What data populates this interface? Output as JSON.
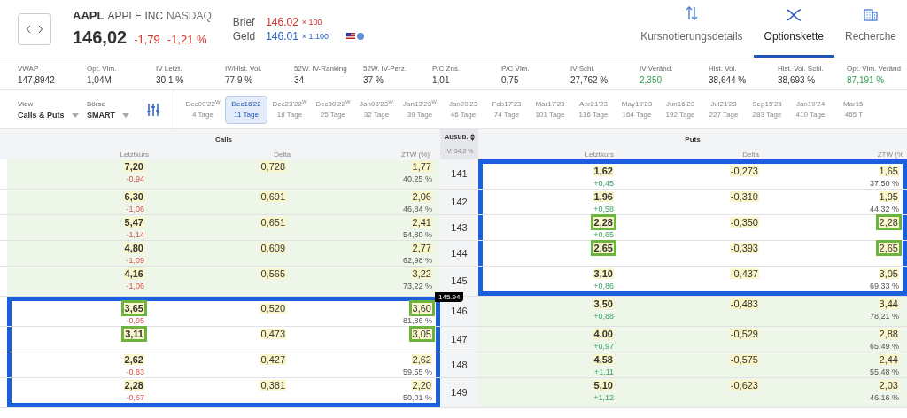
{
  "quote": {
    "symbol": "AAPL",
    "name": "APPLE INC",
    "exchange": "NASDAQ",
    "price": "146,02",
    "change": "-1,79",
    "change_pct": "-1,21 %",
    "bid_label": "Brief",
    "bid": "146.02",
    "bid_size": "× 100",
    "ask_label": "Geld",
    "ask": "146.01",
    "ask_size": "× 1.100"
  },
  "tabs": [
    {
      "label": "Kursnotierungsdetails",
      "selected": false
    },
    {
      "label": "Optionskette",
      "selected": true
    },
    {
      "label": "Recherche",
      "selected": false
    }
  ],
  "stats": [
    {
      "label": "VWAP",
      "value": "147,8942",
      "kind": "plain"
    },
    {
      "label": "Opt. Vlm.",
      "value": "1,04M",
      "kind": "plain"
    },
    {
      "label": "IV Letzt.",
      "value": "30,1 %",
      "kind": "plain"
    },
    {
      "label": "IV/Hist. Vol.",
      "value": "77,9 %",
      "kind": "plain"
    },
    {
      "label": "52W. IV-Ranking",
      "value": "34",
      "kind": "plain"
    },
    {
      "label": "52W. IV-Perz.",
      "value": "37 %",
      "kind": "plain"
    },
    {
      "label": "P/C Zns.",
      "value": "1,01",
      "kind": "plain"
    },
    {
      "label": "P/C Vlm.",
      "value": "0,75",
      "kind": "plain"
    },
    {
      "label": "IV Schl.",
      "value": "27,762 %",
      "kind": "plain"
    },
    {
      "label": "IV Veränd.",
      "value": "2,350",
      "kind": "positive"
    },
    {
      "label": "Hist. Vol.",
      "value": "38,644 %",
      "kind": "plain"
    },
    {
      "label": "Hist. Vol. Schl.",
      "value": "38,693 %",
      "kind": "plain"
    },
    {
      "label": "Opt. Vlm. Veränd",
      "value": "87,191 %",
      "kind": "positive"
    }
  ],
  "view": {
    "label": "View",
    "value": "Calls & Puts"
  },
  "exchange_select": {
    "label": "Börse",
    "value": "SMART"
  },
  "expiries": [
    {
      "date": "Dec09'22$^{W}$",
      "days": "4 Tage",
      "selected": false
    },
    {
      "date": "Dec16'22",
      "days": "11 Tage",
      "selected": true
    },
    {
      "date": "Dec23'22$^{W}$",
      "days": "18 Tage",
      "selected": false
    },
    {
      "date": "Dec30'22$^{W}$",
      "days": "25 Tage",
      "selected": false
    },
    {
      "date": "Jan06'23$^{W}$",
      "days": "32 Tage",
      "selected": false
    },
    {
      "date": "Jan13'23$^{W}$",
      "days": "39 Tage",
      "selected": false
    },
    {
      "date": "Jan20'23",
      "days": "46 Tage",
      "selected": false
    },
    {
      "date": "Feb17'23",
      "days": "74 Tage",
      "selected": false
    },
    {
      "date": "Mar17'23",
      "days": "101 Tage",
      "selected": false
    },
    {
      "date": "Apr21'23",
      "days": "136 Tage",
      "selected": false
    },
    {
      "date": "May19'23",
      "days": "164 Tage",
      "selected": false
    },
    {
      "date": "Jun16'23",
      "days": "192 Tage",
      "selected": false
    },
    {
      "date": "Jul21'23",
      "days": "227 Tage",
      "selected": false
    },
    {
      "date": "Sep15'23",
      "days": "283 Tage",
      "selected": false
    },
    {
      "date": "Jan19'24",
      "days": "410 Tage",
      "selected": false
    },
    {
      "date": "Mar15'",
      "days": "465 T",
      "selected": false
    }
  ],
  "table": {
    "calls_title": "Calls",
    "puts_title": "Puts",
    "strike_title": "Ausüb.",
    "iv": "IV: 34,2 %",
    "call_columns": [
      "Letztkurs",
      "Delta",
      "ZTW (%)"
    ],
    "put_columns": [
      "Letztkurs",
      "Delta",
      "ZTW (%"
    ],
    "rows": [
      {
        "strike": "141",
        "call": {
          "in_the_money": true,
          "last": "7,20",
          "change": "-0,94",
          "delta": "0,728",
          "ztw": "1,77",
          "ztw_pct": "40,25 %",
          "framed": false
        },
        "put": {
          "in_the_money": false,
          "last": "1,62",
          "change": "+0,45",
          "delta": "-0,273",
          "ztw": "1,65",
          "ztw_pct": "37,50 %",
          "framed": false
        }
      },
      {
        "strike": "142",
        "call": {
          "in_the_money": true,
          "last": "6,30",
          "change": "-1,06",
          "delta": "0,691",
          "ztw": "2,06",
          "ztw_pct": "46,84 %",
          "framed": false
        },
        "put": {
          "in_the_money": false,
          "last": "1,96",
          "change": "+0,58",
          "delta": "-0,310",
          "ztw": "1,95",
          "ztw_pct": "44,32 %",
          "framed": false
        }
      },
      {
        "strike": "143",
        "call": {
          "in_the_money": true,
          "last": "5,47",
          "change": "-1,14",
          "delta": "0,651",
          "ztw": "2,41",
          "ztw_pct": "54,80 %",
          "framed": false
        },
        "put": {
          "in_the_money": false,
          "last": "2,28",
          "change": "+0,65",
          "delta": "-0,350",
          "ztw": "2,28",
          "framed": true
        }
      },
      {
        "strike": "144",
        "call": {
          "in_the_money": true,
          "last": "4,80",
          "change": "-1,09",
          "delta": "0,609",
          "ztw": "2,77",
          "ztw_pct": "62,98 %",
          "framed": false
        },
        "put": {
          "in_the_money": false,
          "last": "2,65",
          "delta": "-0,393",
          "ztw": "2,65",
          "framed": true
        }
      },
      {
        "strike": "145",
        "price_marker": "145.94",
        "call": {
          "in_the_money": true,
          "last": "4,16",
          "change": "-1,06",
          "delta": "0,565",
          "ztw": "3,22",
          "ztw_pct": "73,22 %",
          "framed": false
        },
        "put": {
          "in_the_money": false,
          "last": "3,10",
          "change": "+0,86",
          "delta": "-0,437",
          "ztw": "3,05",
          "ztw_pct": "69,33 %",
          "framed": false
        }
      },
      {
        "strike": "146",
        "call": {
          "in_the_money": false,
          "last": "3,65",
          "change": "-0,95",
          "delta": "0,520",
          "ztw": "3,60",
          "ztw_pct": "81,86 %",
          "framed": true
        },
        "put": {
          "in_the_money": true,
          "last": "3,50",
          "change": "+0,88",
          "delta": "-0,483",
          "ztw": "3,44",
          "ztw_pct": "78,21 %",
          "framed": false
        }
      },
      {
        "strike": "147",
        "call": {
          "in_the_money": false,
          "last": "3,11",
          "delta": "0,473",
          "ztw": "3,05",
          "framed": true
        },
        "put": {
          "in_the_money": true,
          "last": "4,00",
          "change": "+0,97",
          "delta": "-0,529",
          "ztw": "2,88",
          "ztw_pct": "65,49 %",
          "framed": false
        }
      },
      {
        "strike": "148",
        "call": {
          "in_the_money": false,
          "last": "2,62",
          "change": "-0,83",
          "delta": "0,427",
          "ztw": "2,62",
          "ztw_pct": "59,55 %",
          "framed": false
        },
        "put": {
          "in_the_money": true,
          "last": "4,58",
          "change": "+1,11",
          "delta": "-0,575",
          "ztw": "2,44",
          "ztw_pct": "55,48 %",
          "framed": false
        }
      },
      {
        "strike": "149",
        "call": {
          "in_the_money": false,
          "last": "2,28",
          "change": "-0,67",
          "delta": "0,381",
          "ztw": "2,20",
          "ztw_pct": "50,01 %",
          "framed": false
        },
        "put": {
          "in_the_money": true,
          "last": "5,10",
          "change": "+1,12",
          "delta": "-0,623",
          "ztw": "2,03",
          "ztw_pct": "46,16 %",
          "framed": false
        }
      }
    ]
  }
}
